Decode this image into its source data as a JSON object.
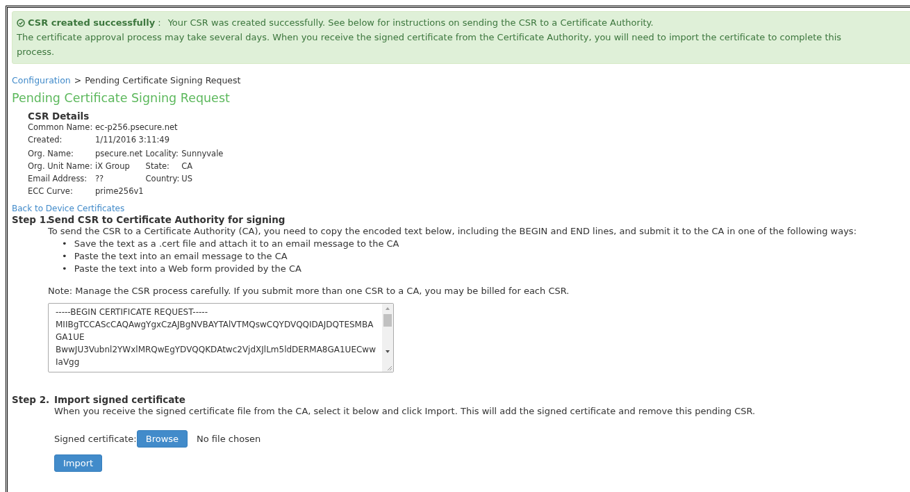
{
  "alert": {
    "title": "CSR created successfully",
    "separator": ":",
    "message": "Your CSR was created successfully. See below for instructions on sending the CSR to a Certificate Authority.",
    "detail": "The certificate approval process may take several days. When you receive the signed certificate from the Certificate Authority, you will need to import the certificate to complete this process."
  },
  "breadcrumb": {
    "link": "Configuration",
    "separator": ">",
    "current": "Pending Certificate Signing Request"
  },
  "page_title": "Pending Certificate Signing Request",
  "details": {
    "title": "CSR Details",
    "groups": [
      [
        {
          "cells": [
            "Common Name:",
            "ec-p256.psecure.net"
          ]
        },
        {
          "cells": [
            "Created:",
            "1/11/2016 3:11:49"
          ]
        }
      ],
      [
        {
          "cells": [
            "Org. Name:",
            "psecure.net",
            "Locality:",
            "Sunnyvale"
          ]
        },
        {
          "cells": [
            "Org. Unit Name:",
            "iX Group",
            "State:",
            "CA"
          ]
        },
        {
          "cells": [
            "Email Address:",
            "??",
            "Country:",
            "US"
          ]
        },
        {
          "cells": [
            "ECC Curve:",
            "prime256v1"
          ]
        }
      ]
    ]
  },
  "back_link": "Back to Device Certificates",
  "step1": {
    "number": "Step 1.",
    "title": "Send CSR to Certificate Authority for signing",
    "intro": "To send the CSR to a Certificate Authority (CA), you need to copy the encoded text below, including the BEGIN and END lines, and submit it to the CA in one of the following ways:",
    "bullets": [
      {
        "marker": "•",
        "text": "Save the text as a .cert file and attach it to an email message to the CA"
      },
      {
        "marker": "•",
        "text": "Paste the text into an email message to the CA"
      },
      {
        "marker": "•",
        "text": "Paste the text into a Web form provided by the CA"
      }
    ],
    "note": "Note: Manage the CSR process carefully. If you submit more than one CSR to a CA, you may be billed for each CSR.",
    "csr_lines": [
      "-----BEGIN CERTIFICATE REQUEST-----",
      "MIIBgTCCAScCAQAwgYgxCzAJBgNVBAYTAlVTMQswCQYDVQQIDAJDQTESMBA",
      "GA1UE",
      "BwwJU3Vubnl2YWxlMRQwEgYDVQQKDAtwc2VjdXJlLm5ldDERMA8GA1UECww",
      "IaVgg"
    ]
  },
  "step2": {
    "number": "Step 2.",
    "title": "Import signed certificate",
    "intro": "When you receive the signed certificate file from the CA, select it below and click Import. This will add the signed certificate and remove this pending CSR.",
    "file_label": "Signed certificate:",
    "browse_button": "Browse",
    "file_status": "No file chosen",
    "import_button": "Import"
  }
}
